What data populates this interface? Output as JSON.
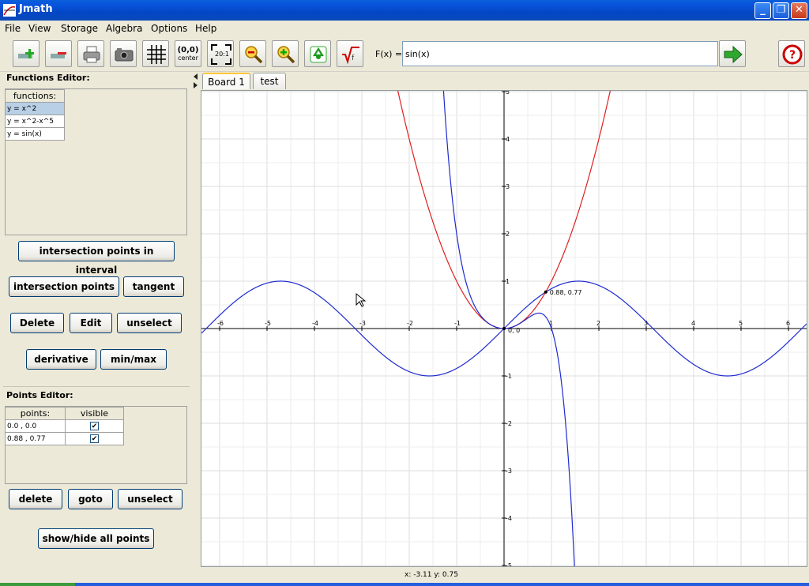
{
  "window": {
    "title": "Jmath"
  },
  "menu": [
    "File",
    "View",
    "Storage",
    "Algebra",
    "Options",
    "Help"
  ],
  "toolbar": {
    "buttons": [
      "add-function-icon",
      "remove-function-icon",
      "print-icon",
      "camera-icon",
      "grid-icon",
      "center-icon",
      "fit-icon",
      "zoom-out-icon",
      "zoom-in-icon",
      "recycle-icon",
      "root-icon"
    ],
    "center_label": "(0,0)",
    "center_sub": "center",
    "fit_label": "20:1",
    "fx_label": "F(x) =",
    "fx_value": "sin(x)"
  },
  "functions_editor": {
    "title": "Functions Editor:",
    "header": "functions:",
    "items": [
      "y = x^2",
      "y = x^2-x^5",
      "y = sin(x)"
    ],
    "selected": 0,
    "btn_interval": "intersection points in interval",
    "btn_intersection": "intersection points",
    "btn_tangent": "tangent",
    "btn_delete": "Delete",
    "btn_edit": "Edit",
    "btn_unselect": "unselect",
    "btn_derivative": "derivative",
    "btn_minmax": "min/max"
  },
  "points_editor": {
    "title": "Points Editor:",
    "col_points": "points:",
    "col_visible": "visible",
    "rows": [
      {
        "point": "0.0 , 0.0",
        "visible": "✔"
      },
      {
        "point": "0.88 , 0.77",
        "visible": "✔"
      }
    ],
    "btn_delete": "delete",
    "btn_goto": "goto",
    "btn_unselect": "unselect",
    "btn_showhide": "show/hide all points"
  },
  "tabs": [
    "Board 1",
    "test"
  ],
  "active_tab": 0,
  "status": "x: -3.11  y: 0.75",
  "chart_data": {
    "type": "line",
    "xlim": [
      -6.3,
      6.4
    ],
    "ylim": [
      -5,
      5
    ],
    "x_ticks": [
      "-6",
      "-5",
      "-4",
      "-3",
      "-2",
      "-1",
      "1",
      "2",
      "3",
      "4",
      "5",
      "6"
    ],
    "y_ticks": [
      "5",
      "4",
      "3",
      "2",
      "1",
      "-1",
      "-2",
      "-3",
      "-4",
      "-5"
    ],
    "grid": true,
    "series": [
      {
        "formula": "x^2",
        "color": "#E02020"
      },
      {
        "formula": "x^2-x^5",
        "color": "#1E2BD0"
      },
      {
        "formula": "sin(x)",
        "color": "#1E2BD0"
      }
    ],
    "points": [
      {
        "x": 0,
        "y": 0,
        "label": "0, 0"
      },
      {
        "x": 0.88,
        "y": 0.77,
        "label": "0.88, 0.77"
      }
    ]
  }
}
